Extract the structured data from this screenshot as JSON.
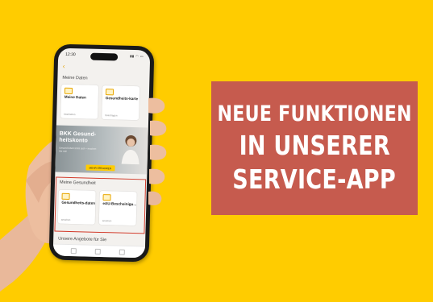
{
  "banner": {
    "line1": "NEUE FUNKTIONEN",
    "line2": "IN UNSERER",
    "line3": "SERVICE-APP"
  },
  "colors": {
    "background": "#FFCC00",
    "banner": "#C65B4E",
    "highlight": "#D23B2B"
  },
  "app": {
    "status_time": "12:30",
    "section_my_data": "Meine Daten",
    "cards_my_data": [
      {
        "title": "Meine Daten",
        "sub": "bearbeiten"
      },
      {
        "title": "Gesundheits-karte",
        "sub": "beantragen"
      }
    ],
    "promo": {
      "title": "BKK Gesund-heitskonto",
      "sub": "Gesund leben lohnt sich – machen Sie mit!",
      "button": "MEHR ERFAHREN"
    },
    "section_my_health": "Meine Gesundheit",
    "cards_my_health": [
      {
        "title": "Gesundheits-daten",
        "sub": "ansehen"
      },
      {
        "title": "eAU-Bescheinigu...",
        "sub": "ansehen"
      }
    ],
    "section_offers": "Unsere Angebote für Sie"
  }
}
